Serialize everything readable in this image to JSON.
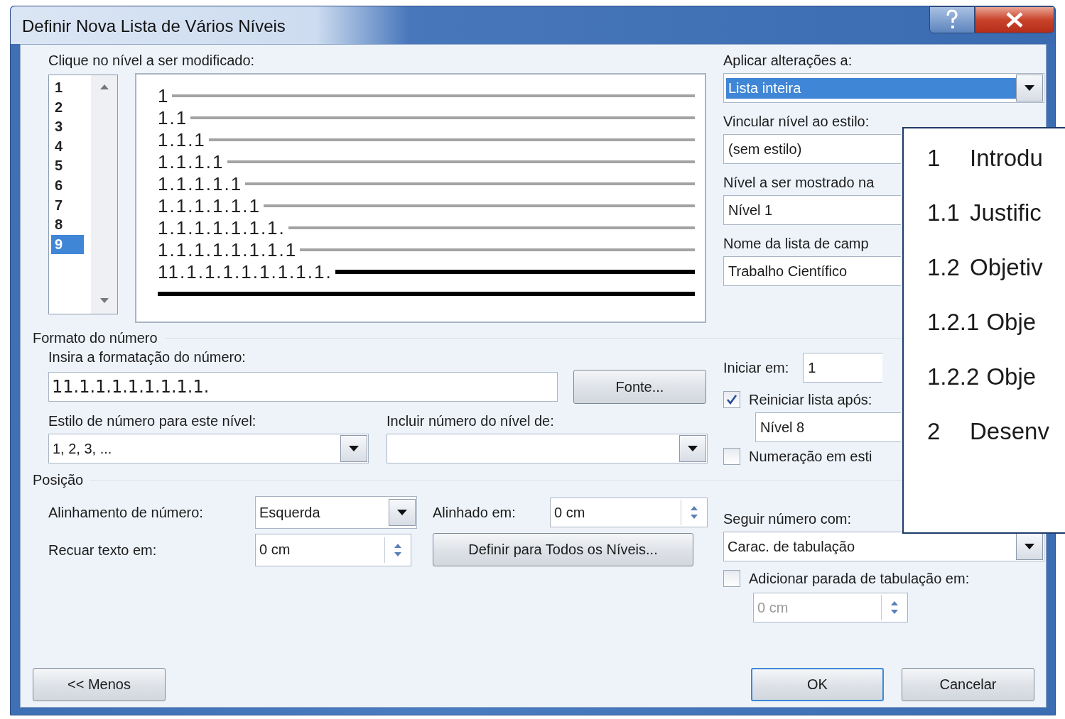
{
  "window": {
    "title": "Definir Nova Lista de Vários Níveis"
  },
  "levels": {
    "label": "Clique no nível a ser modificado:",
    "items": [
      {
        "label": "1",
        "selected": false
      },
      {
        "label": "2",
        "selected": false
      },
      {
        "label": "3",
        "selected": false
      },
      {
        "label": "4",
        "selected": false
      },
      {
        "label": "5",
        "selected": false
      },
      {
        "label": "6",
        "selected": false
      },
      {
        "label": "7",
        "selected": false
      },
      {
        "label": "8",
        "selected": false
      },
      {
        "label": "9",
        "selected": true
      }
    ]
  },
  "preview": {
    "lines": [
      {
        "number": "1",
        "selected": false
      },
      {
        "number": "1.1",
        "selected": false
      },
      {
        "number": "1.1.1",
        "selected": false
      },
      {
        "number": "1.1.1.1",
        "selected": false
      },
      {
        "number": "1.1.1.1.1",
        "selected": false
      },
      {
        "number": "1.1.1.1.1.1",
        "selected": false
      },
      {
        "number": "1.1.1.1.1.1.1.",
        "selected": false
      },
      {
        "number": "1.1.1.1.1.1.1.1",
        "selected": false
      },
      {
        "number": "11.1.1.1.1.1.1.1.1.",
        "selected": true
      }
    ]
  },
  "apply_to": {
    "label": "Aplicar alterações a:",
    "value": "Lista inteira",
    "focused": true
  },
  "link_style": {
    "label": "Vincular nível ao estilo:",
    "value": "(sem estilo)"
  },
  "gallery_level": {
    "label": "Nível a ser mostrado na",
    "value": "Nível 1"
  },
  "listnum_field": {
    "label": "Nome da lista de camp",
    "value": "Trabalho Científico"
  },
  "number_format": {
    "title": "Formato do número",
    "format_label": "Insira a formatação do número:",
    "format_value": "11.1.1.1.1.1.1.1.1.",
    "font_button": "Fonte...",
    "style_label": "Estilo de número para este nível:",
    "style_value": "1, 2, 3, ...",
    "include_label": "Incluir número do nível de:"
  },
  "start_at": {
    "label": "Iniciar em:",
    "value": "1"
  },
  "restart": {
    "label": "Reiniciar lista após:",
    "checked": true,
    "value": "Nível 8"
  },
  "legal": {
    "label": "Numeração em esti",
    "checked": false
  },
  "position": {
    "title": "Posição",
    "alignment_label": "Alinhamento de número:",
    "alignment_value": "Esquerda",
    "aligned_at_label": "Alinhado em:",
    "aligned_at_value": "0 cm",
    "indent_label": "Recuar texto em:",
    "indent_value": "0 cm",
    "set_all_button": "Definir para Todos os Níveis..."
  },
  "follow": {
    "label": "Seguir número com:",
    "value": "Carac. de tabulação"
  },
  "tab_stop": {
    "label": "Adicionar parada de tabulação em:",
    "checked": false,
    "value": "0 cm",
    "disabled": true
  },
  "buttons": [
    {
      "label": "<< Menos",
      "default": false
    },
    {
      "label": "OK",
      "default": true
    },
    {
      "label": "Cancelar",
      "default": false
    }
  ],
  "overlay": {
    "items": [
      {
        "number": "1",
        "title": "Introdu"
      },
      {
        "number": "1.1",
        "title": "Justific"
      },
      {
        "number": "1.2",
        "title": "Objetiv"
      },
      {
        "number": "1.2.1",
        "title": "Obje"
      },
      {
        "number": "1.2.2",
        "title": "Obje"
      },
      {
        "number": "2",
        "title": "Desenv"
      }
    ]
  }
}
